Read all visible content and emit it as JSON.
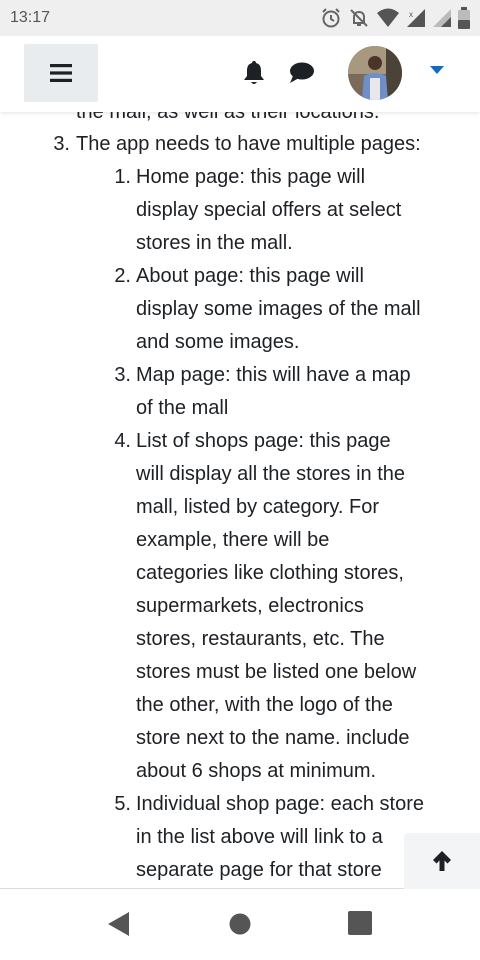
{
  "status_bar": {
    "time": "13:17",
    "icons": [
      "alarm-icon",
      "bell-off-icon",
      "wifi-icon",
      "signal-icon",
      "signal-icon",
      "battery-icon"
    ]
  },
  "navbar": {
    "menu_icon": "hamburger-icon",
    "notification_icon": "bell-icon",
    "messages_icon": "chat-bubble-icon",
    "user_menu_icon": "chevron-down-icon",
    "accent_color": "#0f6cbf"
  },
  "content": {
    "cut_off_text": "the mall, as well as their locations.",
    "item_number": "3.",
    "item_text": "The app needs to have multiple pages:",
    "subitems": [
      {
        "number": "1.",
        "lines": [
          "Home page: this page will",
          "display special offers at select",
          "stores in the mall."
        ]
      },
      {
        "number": "2.",
        "lines": [
          "About page: this page will",
          "display some images of the mall",
          "and some images."
        ]
      },
      {
        "number": "3.",
        "lines": [
          "Map page: this will have a map",
          "of the mall"
        ]
      },
      {
        "number": "4.",
        "lines": [
          "List of shops page: this page",
          "will display all the stores in the",
          "mall, listed by category. For",
          "example, there will be",
          "categories like clothing stores,",
          "supermarkets, electronics",
          "stores, restaurants, etc. The",
          "stores must be listed one below",
          "the other, with the logo of the",
          "store next to the name. include",
          "about 6 shops at minimum."
        ]
      },
      {
        "number": "5.",
        "lines": [
          "Individual shop page: each store",
          "in the list above will link to a",
          "separate page for that store"
        ]
      }
    ]
  },
  "scroll_top": {
    "icon": "arrow-up-icon"
  },
  "bottom_nav": {
    "icons": [
      "back-triangle-icon",
      "home-circle-icon",
      "recents-square-icon"
    ]
  }
}
